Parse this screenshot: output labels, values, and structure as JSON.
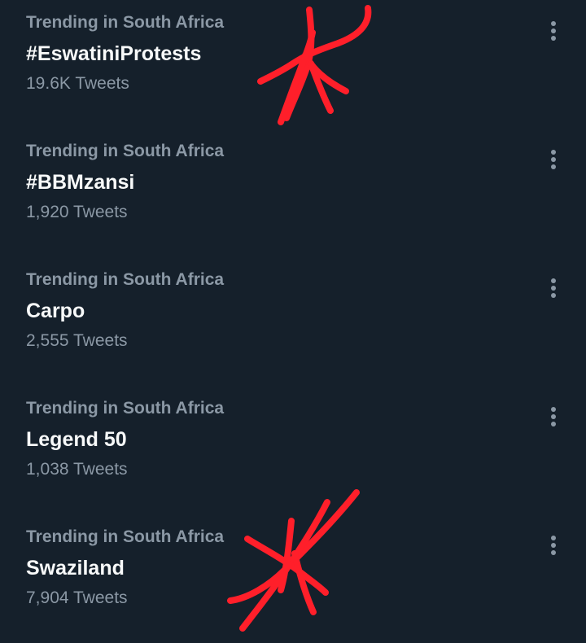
{
  "trends": [
    {
      "context": "Trending in South Africa",
      "name": "#EswatiniProtests",
      "count": "19.6K Tweets"
    },
    {
      "context": "Trending in South Africa",
      "name": "#BBMzansi",
      "count": "1,920 Tweets"
    },
    {
      "context": "Trending in South Africa",
      "name": "Carpo",
      "count": "2,555 Tweets"
    },
    {
      "context": "Trending in South Africa",
      "name": "Legend 50",
      "count": "1,038 Tweets"
    },
    {
      "context": "Trending in South Africa",
      "name": "Swaziland",
      "count": "7,904 Tweets"
    }
  ],
  "icons": {
    "more": "more-horizontal-icon",
    "annotation": "red-scribble-annotation"
  },
  "colors": {
    "background": "#15202b",
    "primary_text": "#f7f9f9",
    "secondary_text": "#8b98a5",
    "annotation": "#ff1f2a"
  }
}
